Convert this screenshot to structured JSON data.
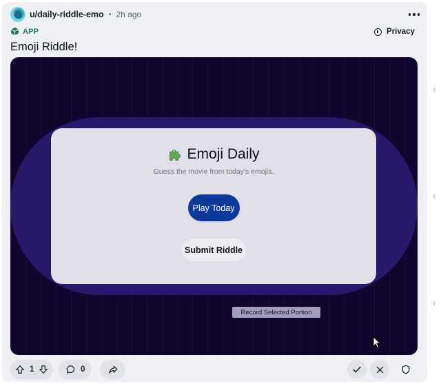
{
  "post": {
    "author": "u/daily-riddle-emo",
    "separator": "•",
    "time": "2h ago",
    "app_badge": "APP",
    "privacy_label": "Privacy",
    "title": "Emoji Riddle!"
  },
  "app": {
    "title": "Emoji Daily",
    "title_emoji_icon": "puzzle-piece-icon",
    "subtitle": "Guess the movie from today's emojis.",
    "play_label": "Play Today",
    "submit_label": "Submit Riddle",
    "record_label": "Record Selected Portion"
  },
  "footer": {
    "vote_count": "1",
    "comment_count": "0"
  },
  "colors": {
    "app_background": "#10062d",
    "oval": "#28186a",
    "panel": "#e1e0ea",
    "play_button": "#0a3a9b",
    "app_badge": "#1f7a55"
  }
}
